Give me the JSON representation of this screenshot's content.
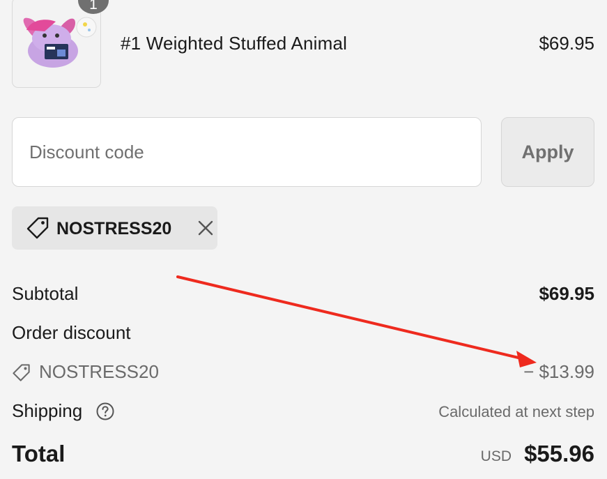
{
  "line_item": {
    "quantity": "1",
    "name": "#1 Weighted Stuffed Animal",
    "price": "$69.95",
    "image_icon": "plush-bunny-image"
  },
  "discount": {
    "placeholder": "Discount code",
    "value": "",
    "apply_label": "Apply",
    "applied_code": "NOSTRESS20",
    "tag_icon": "tag-icon",
    "remove_icon": "close-icon"
  },
  "summary": {
    "subtotal_label": "Subtotal",
    "subtotal_value": "$69.95",
    "order_discount_label": "Order discount",
    "discount_code": "NOSTRESS20",
    "discount_value": "− $13.99",
    "shipping_label": "Shipping",
    "shipping_help_icon": "question-circle-icon",
    "shipping_value": "Calculated at next step",
    "total_label": "Total",
    "total_currency": "USD",
    "total_value": "$55.96"
  },
  "colors": {
    "background": "#f4f4f4",
    "text": "#1a1a1a",
    "muted": "#6a6a6a",
    "annotation_arrow": "#ee2a1e"
  }
}
